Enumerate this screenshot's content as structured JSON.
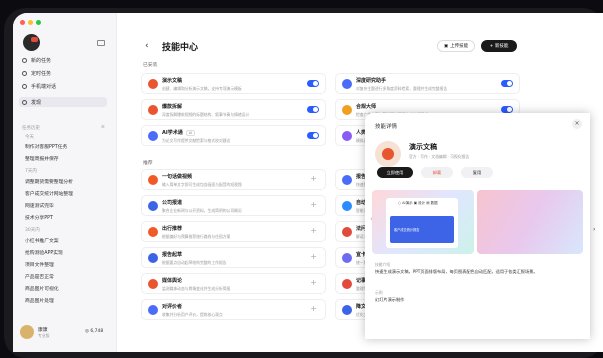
{
  "colors": {
    "accent": "#2b5cff",
    "dark": "#1a1a1a",
    "red": "#e14b3b"
  },
  "sidebar": {
    "nav": [
      {
        "label": "新的任务",
        "icon": "plus-circle-icon"
      },
      {
        "label": "定时任务",
        "icon": "clock-icon"
      },
      {
        "label": "手机端对话",
        "icon": "phone-icon"
      },
      {
        "label": "发现",
        "icon": "discover-icon"
      }
    ],
    "history_header": "任务历史",
    "groups": [
      {
        "label": "今天",
        "items": [
          "制作对客服PPT任务",
          "整理周报并保存"
        ]
      },
      {
        "label": "7天内",
        "items": [
          "调整期货需要整理分析",
          "客户成交统计网站整理",
          "网速测试完毕",
          "技术分享PPT"
        ]
      },
      {
        "label": "30天内",
        "items": [
          "小红书推广文案",
          "抢购测验APP实现",
          "项目文件整理",
          "产品是否正常",
          "商品图片可视化",
          "商品图片处理"
        ]
      }
    ],
    "user": {
      "name": "康康",
      "plan": "专业版",
      "coins": "6,748"
    }
  },
  "header": {
    "back": "‹",
    "title": "技能中心",
    "upload_btn": "上传技能",
    "create_btn": "+ 新技能"
  },
  "sections": {
    "installed": "已安装",
    "recommended": "推荐"
  },
  "installed": [
    {
      "name": "演示文稿",
      "desc": "创建、编辑和分析演示文稿，支持专项演示模板",
      "color": "#e8552e"
    },
    {
      "name": "深度研究助手",
      "desc": "对复杂主题进行多角度资料检索，整理并生成完整报告",
      "color": "#4a6cf7"
    },
    {
      "name": "爆款拆解",
      "desc": "深度拆解爆款视频的标题结构、叙事节奏与情绪设计",
      "color": "#e8552e"
    },
    {
      "name": "合规大师",
      "desc": "检查广告文案与营销素材是否符合法规要求",
      "color": "#f0a020"
    },
    {
      "name": "AI学术通",
      "desc": "为论文写作提供文献检索与格式校对建议",
      "color": "#4a6cf7",
      "badge": "AI"
    },
    {
      "name": "人类互动",
      "desc": "模拟真实用户交流场景",
      "color": "#8a5cf6"
    }
  ],
  "recommended": [
    {
      "name": "一句话做视频",
      "desc": "输入简单文字即可生成包含画面与配音的短视频",
      "color": "#f05a28"
    },
    {
      "name": "报告助手",
      "desc": "快速整理数据并生成结构清晰的报告",
      "color": "#4a6cf7"
    },
    {
      "name": "公司报道",
      "desc": "聚合企业新闻与公开资料，生成简明的公司概况",
      "color": "#3d63e6"
    },
    {
      "name": "自动命名",
      "desc": "智能识别内容并批量重命名文件",
      "color": "#2b8cff"
    },
    {
      "name": "出行推荐",
      "desc": "根据偏好与预算推荐旅行路线与住宿方案",
      "color": "#f05a28"
    },
    {
      "name": "法问律师",
      "desc": "解读法律条文并给出初步建议",
      "color": "#e14b3b"
    },
    {
      "name": "报告起草",
      "desc": "根据要点自动起草结构完整的工作报告",
      "color": "#3d63e6"
    },
    {
      "name": "宣卡管理",
      "desc": "统一管理宣传物料与发布计划",
      "color": "#6c6cf0"
    },
    {
      "name": "媒体舆论",
      "desc": "监测媒体动态与舆情变化并生成分析简报",
      "color": "#e8552e"
    },
    {
      "name": "记事整理",
      "desc": "整理零散记录并归档成清单",
      "color": "#e14b3b"
    },
    {
      "name": "对评价者",
      "desc": "收集并分析用户评价，提炼核心观点",
      "color": "#4a6cf7"
    },
    {
      "name": "降文寂寂",
      "desc": "优化文本表达与阅读节奏",
      "color": "#3d63e6"
    }
  ],
  "popup": {
    "header": "技能详情",
    "name": "演示文稿",
    "meta": "官方 · 写作 · 文档编辑 · 可视化报告",
    "btn_primary": "立即使用",
    "btn_secondary": "卸载",
    "btn_third": "复用",
    "shot_header": "○ AI演示 ▣ 设计 ▤ 数据",
    "shot_caption": "客户成交统计报告",
    "desc_label": "技能介绍",
    "desc": "快速生成演示文稿，PPT页面排版布局，每页图表配色自动匹配，适用于各类汇报场景。",
    "example_label": "示例",
    "example": "幻灯片演示制作"
  }
}
